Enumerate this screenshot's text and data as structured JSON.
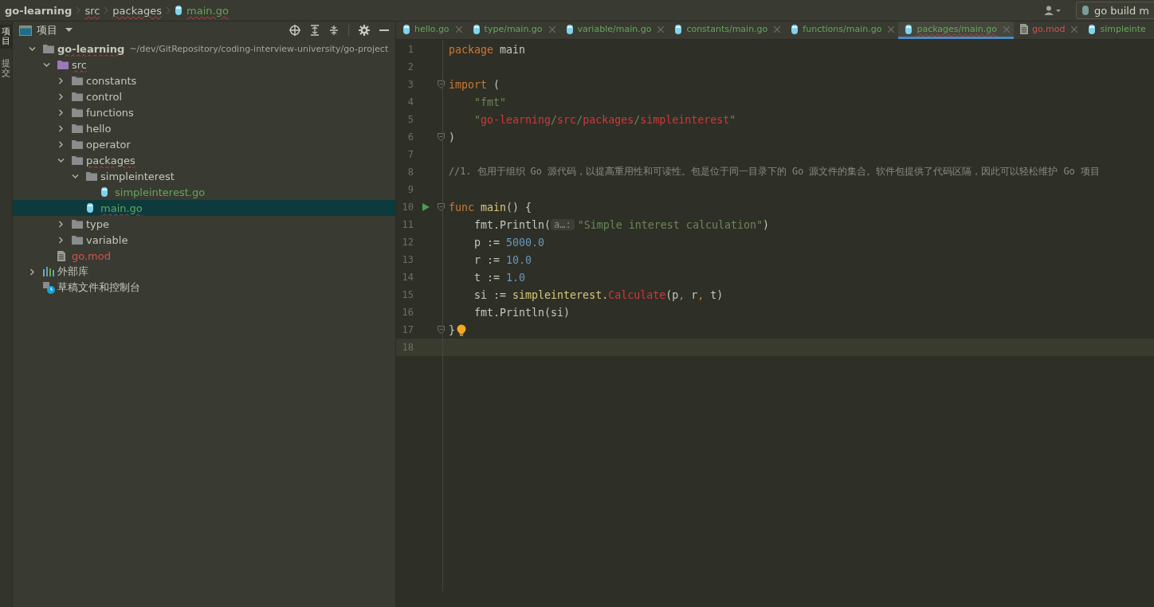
{
  "breadcrumbs": [
    {
      "label": "go-learning",
      "kind": "module",
      "error": false
    },
    {
      "label": "src",
      "kind": "folder",
      "error": true
    },
    {
      "label": "packages",
      "kind": "folder",
      "error": true
    },
    {
      "label": "main.go",
      "kind": "go_file",
      "error": true
    }
  ],
  "run_config": {
    "label": "go build m"
  },
  "side_tabs": [
    {
      "label": "项目",
      "selected": true
    },
    {
      "label": "提交",
      "selected": false
    }
  ],
  "project_panel": {
    "title": "项目"
  },
  "tree": [
    {
      "label": "go-learning",
      "path": "~/dev/GitRepository/coding-interview-university/go-project",
      "kind": "module",
      "expanded": true,
      "selected": false,
      "error": true,
      "children": [
        {
          "label": "src",
          "kind": "source_root",
          "expanded": true,
          "selected": false,
          "error": true,
          "children": [
            {
              "label": "constants",
              "kind": "folder",
              "expanded": false,
              "selected": false,
              "error": false
            },
            {
              "label": "control",
              "kind": "folder",
              "expanded": false,
              "selected": false,
              "error": false
            },
            {
              "label": "functions",
              "kind": "folder",
              "expanded": false,
              "selected": false,
              "error": false
            },
            {
              "label": "hello",
              "kind": "folder",
              "expanded": false,
              "selected": false,
              "error": false
            },
            {
              "label": "operator",
              "kind": "folder",
              "expanded": false,
              "selected": false,
              "error": false
            },
            {
              "label": "packages",
              "kind": "folder",
              "expanded": true,
              "selected": false,
              "error": true,
              "children": [
                {
                  "label": "simpleinterest",
                  "kind": "folder",
                  "expanded": true,
                  "selected": false,
                  "error": false,
                  "children": [
                    {
                      "label": "simpleinterest.go",
                      "kind": "go_file",
                      "color": "#62a85a",
                      "selected": false,
                      "error": false
                    }
                  ]
                },
                {
                  "label": "main.go",
                  "kind": "go_file",
                  "color": "#62a85a",
                  "selected": true,
                  "error": true
                }
              ]
            },
            {
              "label": "type",
              "kind": "folder",
              "expanded": false,
              "selected": false,
              "error": false
            },
            {
              "label": "variable",
              "kind": "folder",
              "expanded": false,
              "selected": false,
              "error": false
            }
          ]
        },
        {
          "label": "go.mod",
          "kind": "mod_file",
          "color": "#d25252",
          "selected": false,
          "error": false
        }
      ]
    },
    {
      "label": "外部库",
      "kind": "libraries",
      "expanded": false,
      "selected": false,
      "error": false
    },
    {
      "label": "草稿文件和控制台",
      "kind": "scratches",
      "selected": false,
      "error": false
    }
  ],
  "tabs": [
    {
      "label": "hello.go",
      "kind": "go_file",
      "color": "#62a85a",
      "selected": false,
      "error": false,
      "closable": true
    },
    {
      "label": "type/main.go",
      "kind": "go_file",
      "color": "#62a85a",
      "selected": false,
      "error": false,
      "closable": true
    },
    {
      "label": "variable/main.go",
      "kind": "go_file",
      "color": "#62a85a",
      "selected": false,
      "error": false,
      "closable": true
    },
    {
      "label": "constants/main.go",
      "kind": "go_file",
      "color": "#62a85a",
      "selected": false,
      "error": false,
      "closable": true
    },
    {
      "label": "functions/main.go",
      "kind": "go_file",
      "color": "#62a85a",
      "selected": false,
      "error": false,
      "closable": true
    },
    {
      "label": "packages/main.go",
      "kind": "go_file",
      "color": "#62a85a",
      "selected": true,
      "error": true,
      "closable": true
    },
    {
      "label": "go.mod",
      "kind": "mod_file",
      "color": "#d25252",
      "selected": false,
      "error": false,
      "closable": true
    },
    {
      "label": "simpleinte",
      "kind": "go_file",
      "color": "#62a85a",
      "selected": false,
      "error": false,
      "closable": false
    }
  ],
  "code_lines": [
    {
      "number": "1",
      "tokens": [
        {
          "kind": "keyword",
          "text": "package"
        },
        {
          "kind": "plain",
          "text": " main"
        }
      ]
    },
    {
      "number": "2"
    },
    {
      "number": "3",
      "fold": true,
      "tokens": [
        {
          "kind": "keyword",
          "text": "import"
        },
        {
          "kind": "plain",
          "text": " ("
        }
      ]
    },
    {
      "number": "4",
      "tokens": [
        {
          "kind": "string",
          "text": "    \"fmt\""
        }
      ]
    },
    {
      "number": "5",
      "tokens": [
        {
          "kind": "string",
          "text": "    \""
        },
        {
          "kind": "error",
          "text": "go-learning"
        },
        {
          "kind": "string",
          "text": "/"
        },
        {
          "kind": "error",
          "text": "src"
        },
        {
          "kind": "string",
          "text": "/"
        },
        {
          "kind": "error",
          "text": "packages"
        },
        {
          "kind": "string",
          "text": "/"
        },
        {
          "kind": "error",
          "text": "simpleinterest"
        },
        {
          "kind": "string",
          "text": "\""
        }
      ]
    },
    {
      "number": "6",
      "fold": true,
      "tokens": [
        {
          "kind": "plain",
          "text": ")"
        }
      ]
    },
    {
      "number": "7"
    },
    {
      "number": "8",
      "tokens": [
        {
          "kind": "comment",
          "text": "//1. 包用于组织 Go 源代码，以提高重用性和可读性。包是位于同一目录下的 Go 源文件的集合。软件包提供了代码区隔，因此可以轻松维护 Go 项目"
        }
      ]
    },
    {
      "number": "9"
    },
    {
      "number": "10",
      "run": true,
      "fold": true,
      "tokens": [
        {
          "kind": "keyword",
          "text": "func"
        },
        {
          "kind": "function",
          "text": " main"
        },
        {
          "kind": "plain",
          "text": "() {"
        }
      ]
    },
    {
      "number": "11",
      "tokens": [
        {
          "kind": "plain",
          "text": "    fmt.Println("
        },
        {
          "kind": "hint",
          "text": "a…:"
        },
        {
          "kind": "string",
          "text": "\"Simple interest calculation\""
        },
        {
          "kind": "plain",
          "text": ")"
        }
      ]
    },
    {
      "number": "12",
      "tokens": [
        {
          "kind": "plain",
          "text": "    p := "
        },
        {
          "kind": "number",
          "text": "5000.0"
        }
      ]
    },
    {
      "number": "13",
      "tokens": [
        {
          "kind": "plain",
          "text": "    r := "
        },
        {
          "kind": "number",
          "text": "10.0"
        }
      ]
    },
    {
      "number": "14",
      "tokens": [
        {
          "kind": "plain",
          "text": "    t := "
        },
        {
          "kind": "number",
          "text": "1.0"
        }
      ]
    },
    {
      "number": "15",
      "tokens": [
        {
          "kind": "plain",
          "text": "    si := "
        },
        {
          "kind": "function",
          "text": "simpleinterest"
        },
        {
          "kind": "plain",
          "text": "."
        },
        {
          "kind": "error",
          "text": "Calculate"
        },
        {
          "kind": "plain",
          "text": "(p"
        },
        {
          "kind": "keyword",
          "text": ","
        },
        {
          "kind": "plain",
          "text": " r"
        },
        {
          "kind": "keyword",
          "text": ","
        },
        {
          "kind": "plain",
          "text": " t)"
        }
      ]
    },
    {
      "number": "16",
      "tokens": [
        {
          "kind": "plain",
          "text": "    fmt.Println(si)"
        }
      ]
    },
    {
      "number": "17",
      "fold": true,
      "bulb": true,
      "tokens": [
        {
          "kind": "plain",
          "text": "}"
        }
      ]
    },
    {
      "number": "18",
      "current": true
    }
  ]
}
